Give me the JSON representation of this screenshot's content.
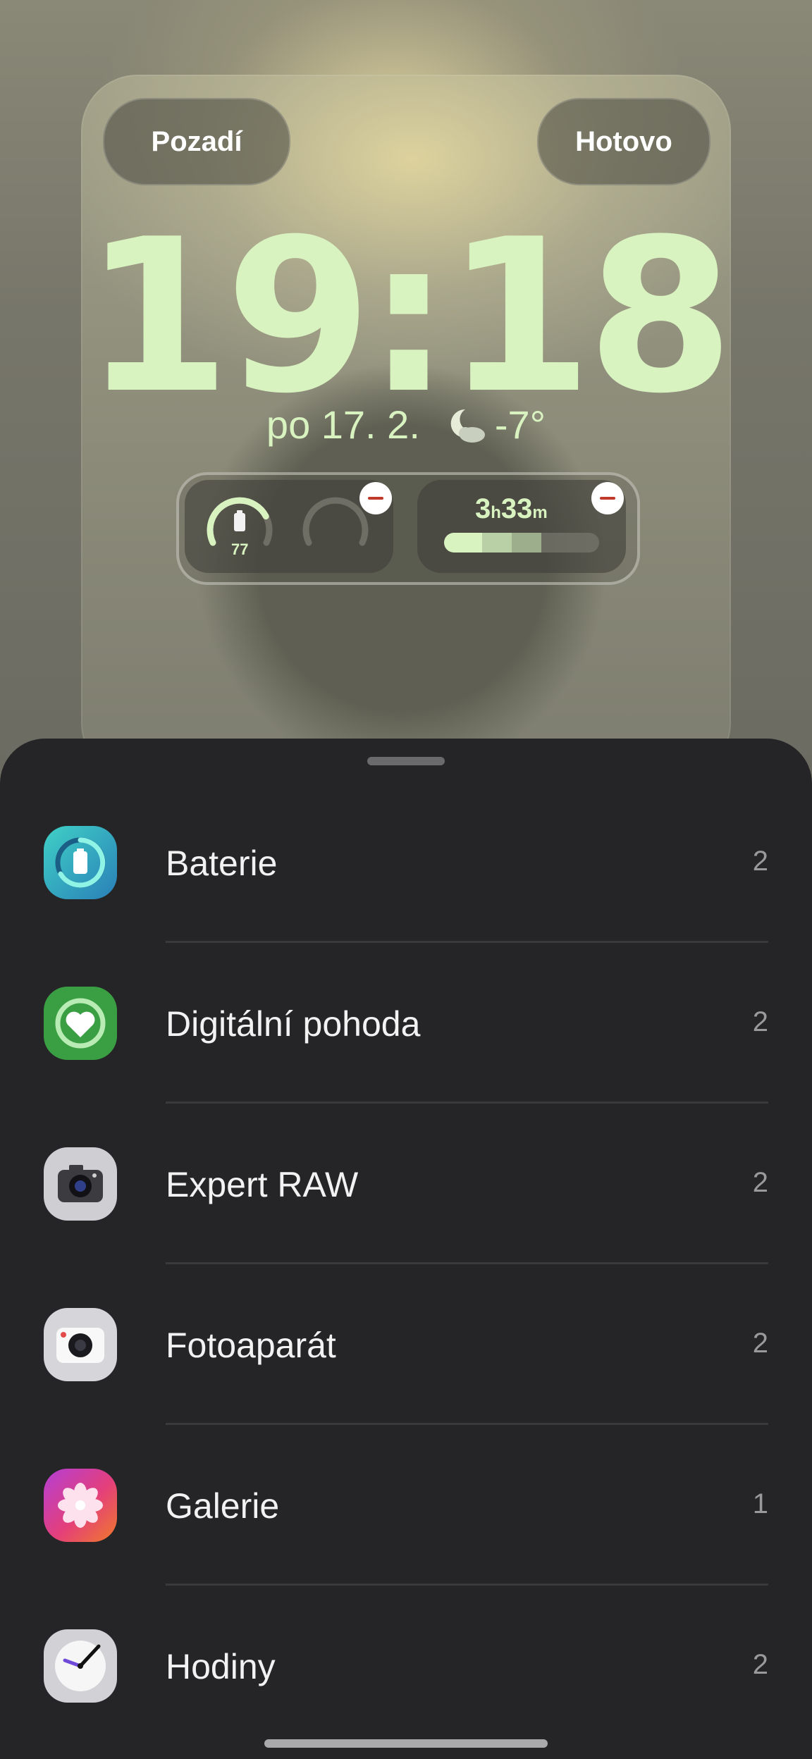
{
  "header": {
    "background_button": "Pozadí",
    "done_button": "Hotovo"
  },
  "lockscreen": {
    "time": "19:18",
    "date": "po 17. 2.",
    "temperature": "-7°",
    "weather_icon": "moon-cloud-icon",
    "text_color": "#d8f2c0"
  },
  "widgets": {
    "battery_level": "77",
    "battery_fraction": 0.77,
    "screen_time_hours": "3",
    "screen_time_h_unit": "h",
    "screen_time_minutes": "33",
    "screen_time_m_unit": "m"
  },
  "list": {
    "items": [
      {
        "label": "Baterie",
        "count": "2",
        "icon": "battery-app-icon"
      },
      {
        "label": "Digitální pohoda",
        "count": "2",
        "icon": "digital-wellbeing-icon"
      },
      {
        "label": "Expert RAW",
        "count": "2",
        "icon": "expert-raw-icon"
      },
      {
        "label": "Fotoaparát",
        "count": "2",
        "icon": "camera-icon"
      },
      {
        "label": "Galerie",
        "count": "1",
        "icon": "gallery-icon"
      },
      {
        "label": "Hodiny",
        "count": "2",
        "icon": "clock-app-icon"
      }
    ]
  }
}
